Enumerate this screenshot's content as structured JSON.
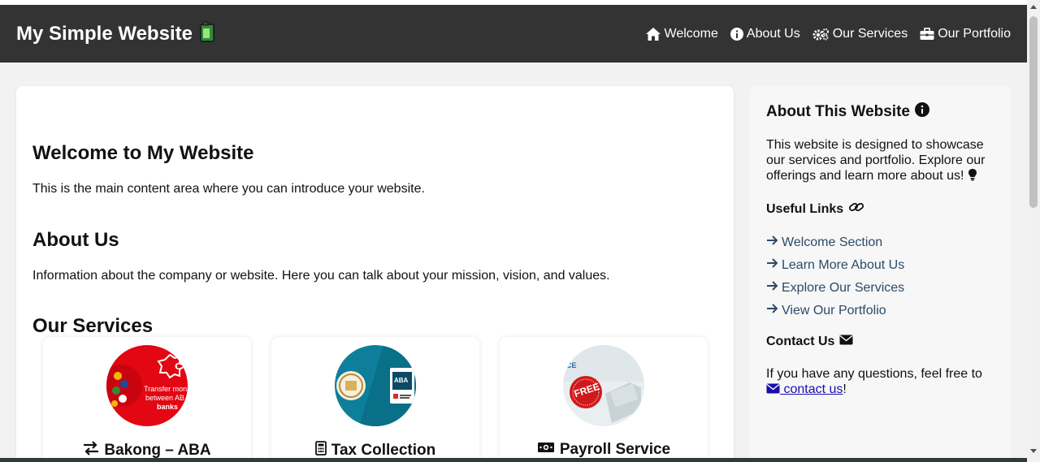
{
  "header": {
    "title": "My Simple Website",
    "nav": [
      {
        "label": "Welcome",
        "icon": "home-icon"
      },
      {
        "label": "About Us",
        "icon": "info-circle-icon"
      },
      {
        "label": "Our Services",
        "icon": "cogs-icon"
      },
      {
        "label": "Our Portfolio",
        "icon": "briefcase-icon"
      }
    ]
  },
  "main": {
    "welcome_heading": "Welcome to My Website",
    "welcome_text": "This is the main content area where you can introduce your website.",
    "about_heading": "About Us",
    "about_text": "Information about the company or website. Here you can talk about your mission, vision, and values.",
    "services_heading": "Our Services",
    "services": [
      {
        "title": "Bakong – ABA",
        "icon": "exchange-icon",
        "image_text": "Transfer mon between AB banks"
      },
      {
        "title": "Tax Collection",
        "icon": "calculator-icon",
        "image_text": "ABA"
      },
      {
        "title": "Payroll Service",
        "icon": "money-bill-icon",
        "image_text": "FREE"
      }
    ]
  },
  "sidebar": {
    "about_heading": "About This Website",
    "about_text": "This website is designed to showcase our services and portfolio. Explore our offerings and learn more about us!",
    "links_heading": "Useful Links",
    "links": [
      "Welcome Section",
      "Learn More About Us",
      "Explore Our Services",
      "View Our Portfolio"
    ],
    "contact_heading": "Contact Us",
    "contact_text": "If you have any questions, feel free to",
    "contact_link": "contact us",
    "contact_suffix": "!"
  },
  "colors": {
    "navbar": "#333333",
    "page_bg": "#f2f2f2",
    "link": "#2c4a68",
    "contact_link": "#1a0dab"
  }
}
